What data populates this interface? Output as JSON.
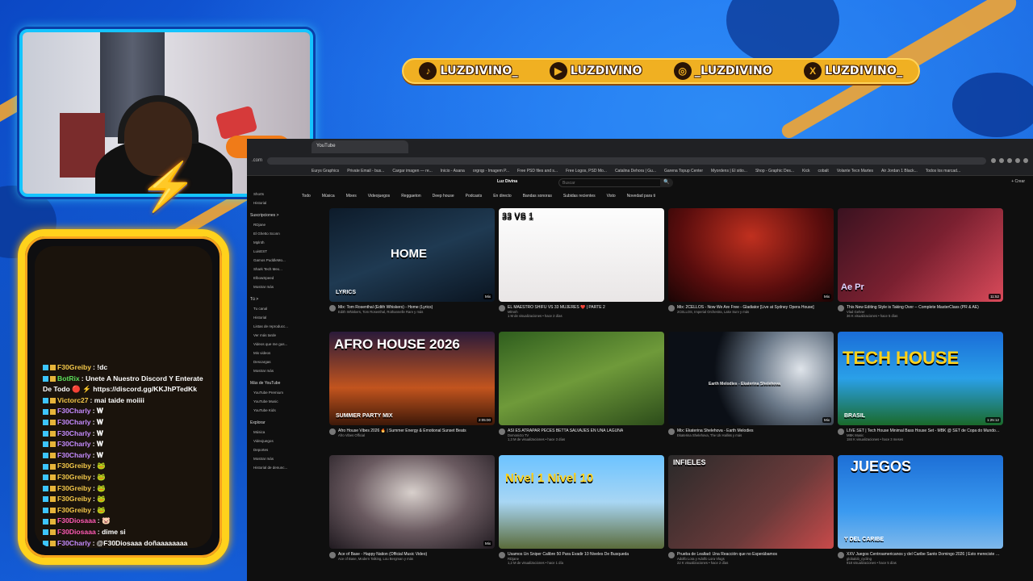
{
  "overlay": {
    "social_handles": [
      {
        "icon": "tiktok-icon",
        "glyph": "♪",
        "handle": "LUZDIVINO_"
      },
      {
        "icon": "youtube-icon",
        "glyph": "▶",
        "handle": "LUZDIVINO"
      },
      {
        "icon": "instagram-icon",
        "glyph": "◎",
        "handle": "_LUZDIVINO"
      },
      {
        "icon": "x-icon",
        "glyph": "X",
        "handle": "LUZDIVINO_"
      }
    ],
    "bolt_glyph": "⚡",
    "colors": {
      "frame_cyan": "#14c4ff",
      "chat_gold": "#ffd21c",
      "banner": "#f0b022",
      "background": "#1560d8"
    }
  },
  "chat": {
    "messages": [
      {
        "user": "F30Greiby",
        "user_color": "#f5c94a",
        "text": ": !dc"
      },
      {
        "user": "BotRix",
        "user_color": "#5ce05c",
        "text": ": Unete A Nuestro Discord Y Enterate De Todo 🔴 ⚡ https://discord.gg/KKJhPTedKk"
      },
      {
        "user": "Victorc27",
        "user_color": "#f5c94a",
        "text": ": mai taide moiiii"
      },
      {
        "user": "F30Charly",
        "user_color": "#c58bff",
        "text": ": 𝐖"
      },
      {
        "user": "F30Charly",
        "user_color": "#c58bff",
        "text": ": 𝐖"
      },
      {
        "user": "F30Charly",
        "user_color": "#c58bff",
        "text": ": 𝐖"
      },
      {
        "user": "F30Charly",
        "user_color": "#c58bff",
        "text": ": 𝐖"
      },
      {
        "user": "F30Charly",
        "user_color": "#c58bff",
        "text": ": 𝐖"
      },
      {
        "user": "F30Greiby",
        "user_color": "#f5c94a",
        "text": ": 🐸"
      },
      {
        "user": "F30Greiby",
        "user_color": "#f5c94a",
        "text": ": 🐸"
      },
      {
        "user": "F30Greiby",
        "user_color": "#f5c94a",
        "text": ": 🐸"
      },
      {
        "user": "F30Greiby",
        "user_color": "#f5c94a",
        "text": ": 🐸"
      },
      {
        "user": "F30Greiby",
        "user_color": "#f5c94a",
        "text": ": 🐸"
      },
      {
        "user": "F30Diosaaa",
        "user_color": "#ff5ab4",
        "text": ": 🐷"
      },
      {
        "user": "F30Diosaaa",
        "user_color": "#ff5ab4",
        "text": ": dime si"
      },
      {
        "user": "F30Charly",
        "user_color": "#c58bff",
        "text": ": @F30Diosaaa doñaaaaaaaa"
      }
    ]
  },
  "browser": {
    "url_fragment": ".com",
    "tab_label": "YouTube",
    "bookmarks": [
      "Eurys Graphics",
      "Private Email - bus...",
      "Cargar imagen — re...",
      "Inicio - Asana",
      "orgrqp - Imagem P...",
      "Free PSD files and s...",
      "Free Logos, PSD Mo...",
      "Catalina Dehora | Gu...",
      "Garena Topup Center",
      "Myordens | El sitio...",
      "Shop - Graphic Des...",
      "Kick",
      "cobalt",
      "Volante Tecn Martes",
      "Air Jordan 1 Black...",
      "Todos los marcad..."
    ]
  },
  "youtube": {
    "logo": "Luz Divina",
    "search_placeholder": "Buscar",
    "search_btn": "🔍",
    "header_right": "+ Crear",
    "chips": [
      "Todo",
      "Música",
      "Mixes",
      "Videojuegos",
      "Reggaeton",
      "Deep house",
      "Podcasts",
      "En directo",
      "Bandas sonoras",
      "Subidas recientes",
      "Visto",
      "Novedad para ti"
    ],
    "sidebar": [
      {
        "type": "item",
        "label": "Shorts"
      },
      {
        "type": "item",
        "label": "Historial"
      },
      {
        "type": "head",
        "label": "Suscripciones >"
      },
      {
        "type": "item",
        "label": "RDjane"
      },
      {
        "type": "item",
        "label": "El Ghetto Sconn"
      },
      {
        "type": "item",
        "label": "Mplnth"
      },
      {
        "type": "item",
        "label": "LuisEST"
      },
      {
        "type": "item",
        "label": "Gamos PuddleMo..."
      },
      {
        "type": "item",
        "label": "Shark Tech Mex..."
      },
      {
        "type": "item",
        "label": "ElbowSpeed"
      },
      {
        "type": "item",
        "label": "Mostrar más"
      },
      {
        "type": "head",
        "label": "Tú >"
      },
      {
        "type": "item",
        "label": "Tu canal"
      },
      {
        "type": "item",
        "label": "Historial"
      },
      {
        "type": "item",
        "label": "Listas de reproducc..."
      },
      {
        "type": "item",
        "label": "Ver más tarde"
      },
      {
        "type": "item",
        "label": "Videos que me gus..."
      },
      {
        "type": "item",
        "label": "Mis videos"
      },
      {
        "type": "item",
        "label": "Descargas"
      },
      {
        "type": "item",
        "label": "Mostrar más"
      },
      {
        "type": "head",
        "label": "Más de YouTube"
      },
      {
        "type": "item",
        "label": "YouTube Premium"
      },
      {
        "type": "item",
        "label": "YouTube Music"
      },
      {
        "type": "item",
        "label": "YouTube Kids"
      },
      {
        "type": "head",
        "label": "Explorar"
      },
      {
        "type": "item",
        "label": "Música"
      },
      {
        "type": "item",
        "label": "Videojuegos"
      },
      {
        "type": "item",
        "label": "Deportes"
      },
      {
        "type": "item",
        "label": "Mostrar más"
      },
      {
        "type": "item",
        "label": "Historial de denunc..."
      }
    ],
    "videos": [
      {
        "title": "Mix: Tom Rosenthal (Edith Whiskers) - Home (Lyrics)",
        "channel": "Edith Whiskers, Tom Rosenthal, Rothannelle Rare y más",
        "stats": "",
        "duration": "Mix",
        "thumb_text": "HOME",
        "thumb_sub": "LYRICS",
        "bg": "linear-gradient(160deg,#0d1b2a,#1f3a52,#0a1420)",
        "text_color": "#ffffff",
        "text_size": "15px",
        "text_pos": "top:48px;left:76px"
      },
      {
        "title": "EL MAESTRO SHIFU VS 33 MUJERES ❤️ | PARTE 2",
        "channel": "Mlmnh",
        "stats": "1 M de visualizaciones • hace 2 días",
        "duration": "",
        "thumb_text": "33 VS 1",
        "thumb_sub": "",
        "bg": "linear-gradient(180deg,#fdfdfd,#e9e6e6)",
        "text_color": "#111111",
        "text_size": "11px",
        "text_pos": "top:4px;left:4px"
      },
      {
        "title": "Mix: 2CELLOS - Now We Are Free - Gladiator [Live at Sydney Opera House]",
        "channel": "2CELLOS, Imperial Orchestra, Lake Surv y más",
        "stats": "",
        "duration": "Mix",
        "thumb_text": "",
        "thumb_sub": "",
        "bg": "radial-gradient(ellipse at 50% 30%,#c0301f,#5a0d0d 60%,#1a0404)",
        "text_color": "#ffffff",
        "text_size": "10px",
        "text_pos": "top:0;left:0"
      },
      {
        "title": "This New Editing Style is Taking Over -- Complete MasterClass (PR & AE)",
        "channel": "Vlad Gehrer",
        "stats": "36 K visualizaciones • hace 5 días",
        "duration": "11:52",
        "thumb_text": "Ae  Pr",
        "thumb_sub": "",
        "bg": "linear-gradient(135deg,#3a1220,#7a2030,#d94a5a)",
        "text_color": "#e0d4ff",
        "text_size": "11px",
        "text_pos": "top:92px;left:4px"
      },
      {
        "title": "Afro House Vibes 2026 🔥 | Summer Energy & Emotional Sunset Beats",
        "channel": "Afro Vibes Official",
        "stats": "",
        "duration": "2:05:00",
        "thumb_text": "AFRO HOUSE 2026",
        "thumb_sub": "SUMMER PARTY MIX",
        "bg": "linear-gradient(180deg,#2a1a3a,#c2541e 60%,#3d1808)",
        "text_color": "#ffffff",
        "text_size": "17px",
        "text_pos": "top:6px;left:6px"
      },
      {
        "title": "ASÍ ES ATRAPAR PECES BETTA SALVAJES EN UNA LAGUNA",
        "channel": "Dxmonicto TV",
        "stats": "1,3 M de visualizaciones • hace 3 días",
        "duration": "",
        "thumb_text": "",
        "thumb_sub": "",
        "bg": "linear-gradient(160deg,#2f5e1e,#6f9a3a 50%,#2c4c1a)",
        "text_color": "#ffffff",
        "text_size": "10px",
        "text_pos": "top:0;left:0"
      },
      {
        "title": "Mix: Ekaterina Shelehova - Earth Melodies",
        "channel": "Ekaterina Shelehova, The Uk Halliss y más",
        "stats": "",
        "duration": "Mix",
        "thumb_text": "Earth Melodies - Ekaterina Shelehova",
        "thumb_sub": "",
        "bg": "radial-gradient(circle at 80% 40%,#dfe4ea,#6a7888 30%,#0b0f16 60%)",
        "text_color": "#e6e6e6",
        "text_size": "5px",
        "text_pos": "top:62px;left:50px"
      },
      {
        "title": "LIVE SET | Tech House Minimal Bass House Set - MBK @ SET de Copa do Mundo | 17AM Cuhfilter PR",
        "channel": "MBK Music",
        "stats": "184 K visualizaciones • hace 3 meses",
        "duration": "1:25:12",
        "thumb_text": "TECH HOUSE",
        "thumb_sub": "BRASIL",
        "bg": "linear-gradient(180deg,#1a6dd8,#2aa0e8 50%,#1a6a2a)",
        "text_color": "#ffd21c",
        "text_size": "22px",
        "text_pos": "top:20px;left:6px"
      },
      {
        "title": "Ace of Base - Happy Nation (Official Music Video)",
        "channel": "Ace of Base, Modern Talking, Lou Bergman y más",
        "stats": "",
        "duration": "Mix",
        "thumb_text": "",
        "thumb_sub": "",
        "bg": "radial-gradient(ellipse at 50% 40%,#d8d0cc,#6a5a60 50%,#201a20)",
        "text_color": "#ffffff",
        "text_size": "10px",
        "text_pos": "top:0;left:0"
      },
      {
        "title": "Usamos Un Sniper Calibre 50 Para Evadir 10 Niveles De Busqueda",
        "channel": "RDjane",
        "stats": "1,2 M de visualizaciones • hace 1 día",
        "duration": "",
        "thumb_text": "Nivel 1      Nivel 10",
        "thumb_sub": "",
        "bg": "linear-gradient(180deg,#6cc3ff,#a8d6f4 50%,#5a6b3a)",
        "text_color": "#ffd21c",
        "text_size": "15px",
        "text_pos": "top:20px;left:8px"
      },
      {
        "title": "Prueba de Lealtad: Una Reacción que no Esperábamos",
        "channel": "Adolfo Lora y Adolfo Lora Vlogs",
        "stats": "22 K visualizaciones • hace 2 días",
        "duration": "",
        "thumb_text": "INFIELES",
        "thumb_sub": "",
        "bg": "linear-gradient(135deg,#2a2a2a,#6a3a3a 60%,#c84a4a)",
        "text_color": "#ffffff",
        "text_size": "9px",
        "text_pos": "top:4px;left:6px"
      },
      {
        "title": "XXV Juegos Centroamericanos y del Caribe Santo Domingo 2026 | Esto mereciste ciclismo ruta",
        "channel": "globalob_cycling",
        "stats": "918 visualizaciones • hace 5 días",
        "duration": "",
        "thumb_text": "JUEGOS",
        "thumb_sub": "Y DEL CARIBE",
        "bg": "linear-gradient(180deg,#1d6fd6,#3a9af0 60%,#7fb8ea)",
        "text_color": "#ffffff",
        "text_size": "18px",
        "text_pos": "top:4px;left:16px"
      }
    ]
  }
}
